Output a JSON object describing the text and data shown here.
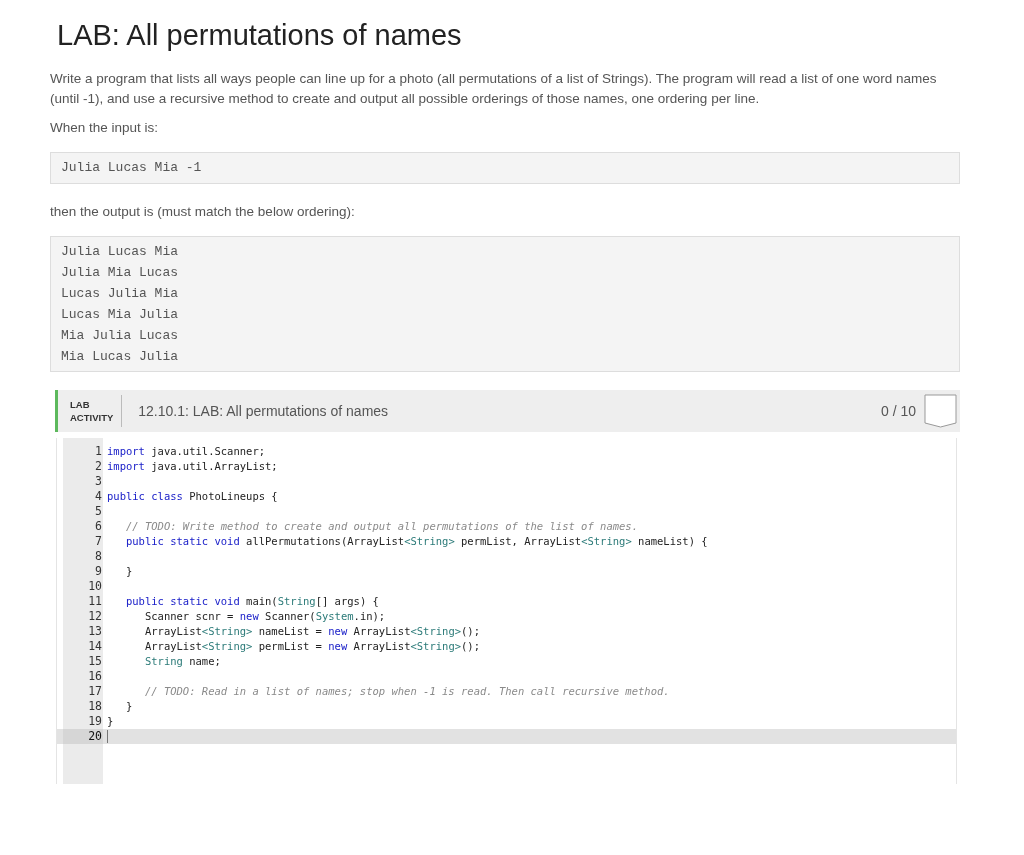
{
  "title": "LAB: All permutations of names",
  "description": "Write a program that lists all ways people can line up for a photo (all permutations of a list of Strings). The program will read a list of one word names (until -1), and use a recursive method to create and output all possible orderings of those names, one ordering per line.",
  "input_label": "When the input is:",
  "input_lines": [
    "Julia Lucas Mia -1"
  ],
  "output_label": "then the output is (must match the below ordering):",
  "output_lines": [
    "Julia Lucas Mia",
    "Julia Mia Lucas",
    "Lucas Julia Mia",
    "Lucas Mia Julia",
    "Mia Julia Lucas",
    "Mia Lucas Julia"
  ],
  "activity": {
    "badge_line1": "LAB",
    "badge_line2": "ACTIVITY",
    "title": "12.10.1: LAB: All permutations of names",
    "score": "0 / 10"
  },
  "code": {
    "lines": [
      {
        "number": "1",
        "active": false,
        "tokens": [
          {
            "kind": "keyword",
            "text": "import"
          },
          {
            "kind": "plain",
            "text": " java.util.Scanner;"
          }
        ]
      },
      {
        "number": "2",
        "active": false,
        "tokens": [
          {
            "kind": "keyword",
            "text": "import"
          },
          {
            "kind": "plain",
            "text": " java.util.ArrayList;"
          }
        ]
      },
      {
        "number": "3",
        "active": false
      },
      {
        "number": "4",
        "active": false,
        "tokens": [
          {
            "kind": "keyword",
            "text": "public class"
          },
          {
            "kind": "plain",
            "text": " PhotoLineups {"
          }
        ]
      },
      {
        "number": "5",
        "active": false
      },
      {
        "number": "6",
        "active": false,
        "tokens": [
          {
            "kind": "comment",
            "text": "   // TODO: Write method to create and output all permutations of the list of names."
          }
        ]
      },
      {
        "number": "7",
        "active": false,
        "tokens": [
          {
            "kind": "keyword",
            "text": "   public static void"
          },
          {
            "kind": "plain",
            "text": " allPermutations(ArrayList"
          },
          {
            "kind": "type",
            "text": "<String>"
          },
          {
            "kind": "plain",
            "text": " permList, ArrayList"
          },
          {
            "kind": "type",
            "text": "<String>"
          },
          {
            "kind": "plain",
            "text": " nameList) {"
          }
        ]
      },
      {
        "number": "8",
        "active": false
      },
      {
        "number": "9",
        "active": false,
        "tokens": [
          {
            "kind": "plain",
            "text": "   }"
          }
        ]
      },
      {
        "number": "10",
        "active": false
      },
      {
        "number": "11",
        "active": false,
        "tokens": [
          {
            "kind": "keyword",
            "text": "   public static void"
          },
          {
            "kind": "plain",
            "text": " main("
          },
          {
            "kind": "type",
            "text": "String"
          },
          {
            "kind": "plain",
            "text": "[] args) {"
          }
        ]
      },
      {
        "number": "12",
        "active": false,
        "tokens": [
          {
            "kind": "plain",
            "text": "      Scanner scnr = "
          },
          {
            "kind": "keyword",
            "text": "new"
          },
          {
            "kind": "plain",
            "text": " Scanner("
          },
          {
            "kind": "type",
            "text": "System"
          },
          {
            "kind": "plain",
            "text": ".in);"
          }
        ]
      },
      {
        "number": "13",
        "active": false,
        "tokens": [
          {
            "kind": "plain",
            "text": "      ArrayList"
          },
          {
            "kind": "type",
            "text": "<String>"
          },
          {
            "kind": "plain",
            "text": " nameList = "
          },
          {
            "kind": "keyword",
            "text": "new"
          },
          {
            "kind": "plain",
            "text": " ArrayList"
          },
          {
            "kind": "type",
            "text": "<String>"
          },
          {
            "kind": "plain",
            "text": "();"
          }
        ]
      },
      {
        "number": "14",
        "active": false,
        "tokens": [
          {
            "kind": "plain",
            "text": "      ArrayList"
          },
          {
            "kind": "type",
            "text": "<String>"
          },
          {
            "kind": "plain",
            "text": " permList = "
          },
          {
            "kind": "keyword",
            "text": "new"
          },
          {
            "kind": "plain",
            "text": " ArrayList"
          },
          {
            "kind": "type",
            "text": "<String>"
          },
          {
            "kind": "plain",
            "text": "();"
          }
        ]
      },
      {
        "number": "15",
        "active": false,
        "tokens": [
          {
            "kind": "type",
            "text": "      String"
          },
          {
            "kind": "plain",
            "text": " name;"
          }
        ]
      },
      {
        "number": "16",
        "active": false
      },
      {
        "number": "17",
        "active": false,
        "tokens": [
          {
            "kind": "comment",
            "text": "      // TODO: Read in a list of names; stop when -1 is read. Then call recursive method."
          }
        ]
      },
      {
        "number": "18",
        "active": false,
        "tokens": [
          {
            "kind": "plain",
            "text": "   }"
          }
        ]
      },
      {
        "number": "19",
        "active": false,
        "tokens": [
          {
            "kind": "plain",
            "text": "}"
          }
        ]
      },
      {
        "number": "20",
        "active": true
      }
    ]
  }
}
